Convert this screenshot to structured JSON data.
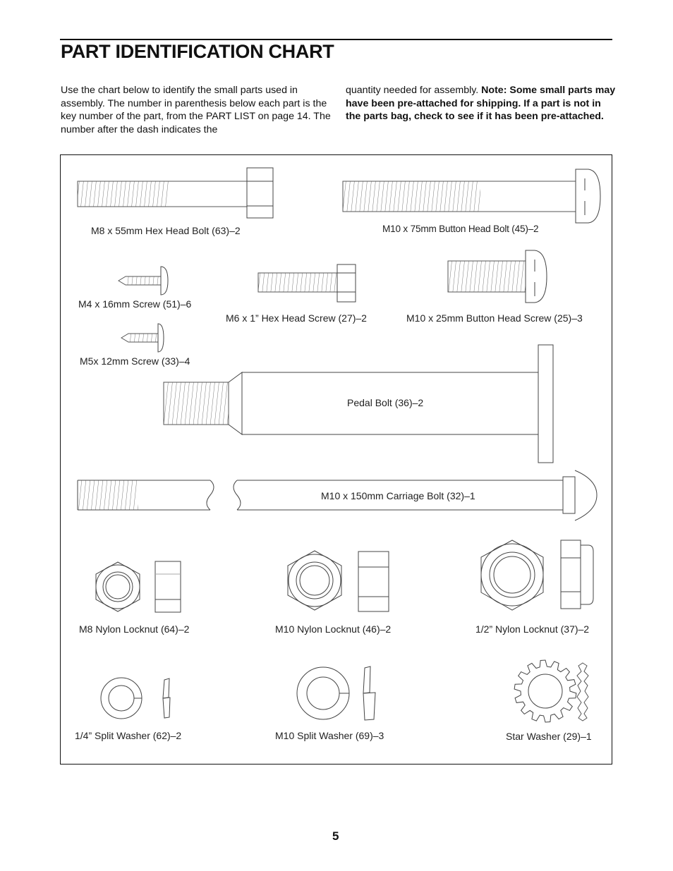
{
  "page": {
    "title": "PART IDENTIFICATION CHART",
    "intro_left": "Use the chart below to identify the small parts used in assembly. The number in parenthesis below each part is the key number of the part, from the PART LIST on page 14. The number after the dash indicates the",
    "intro_right_normal": "quantity needed for assembly. ",
    "intro_right_bold": "Note: Some small parts may have been pre-attached for shipping. If a part is not in the parts bag, check to see if it has been pre-attached.",
    "page_number": "5"
  },
  "parts": [
    {
      "id": "hex-bolt-m8x55",
      "label": "M8 x 55mm Hex Head Bolt (63)–2",
      "key": 63,
      "qty": 2,
      "icon": "hex-head-bolt-icon"
    },
    {
      "id": "button-bolt-m10x75",
      "label": "M10 x 75mm Button Head Bolt (45)–2",
      "key": 45,
      "qty": 2,
      "icon": "button-head-bolt-icon"
    },
    {
      "id": "screw-m4x16",
      "label": "M4 x 16mm Screw (51)–6",
      "key": 51,
      "qty": 6,
      "icon": "screw-icon"
    },
    {
      "id": "hex-screw-m6x1",
      "label": "M6 x 1” Hex Head Screw (27)–2",
      "key": 27,
      "qty": 2,
      "icon": "hex-head-screw-icon"
    },
    {
      "id": "button-screw-m10x25",
      "label": "M10 x 25mm Button Head Screw (25)–3",
      "key": 25,
      "qty": 3,
      "icon": "button-head-screw-icon"
    },
    {
      "id": "screw-m5x12",
      "label": "M5x 12mm Screw (33)–4",
      "key": 33,
      "qty": 4,
      "icon": "screw-icon"
    },
    {
      "id": "pedal-bolt",
      "label": "Pedal Bolt (36)–2",
      "key": 36,
      "qty": 2,
      "icon": "pedal-bolt-icon"
    },
    {
      "id": "carriage-bolt-m10x150",
      "label": "M10 x 150mm Carriage Bolt (32)–1",
      "key": 32,
      "qty": 1,
      "icon": "carriage-bolt-icon"
    },
    {
      "id": "locknut-m8",
      "label": "M8 Nylon Locknut (64)–2",
      "key": 64,
      "qty": 2,
      "icon": "nylon-locknut-icon"
    },
    {
      "id": "locknut-m10",
      "label": "M10 Nylon Locknut (46)–2",
      "key": 46,
      "qty": 2,
      "icon": "nylon-locknut-icon"
    },
    {
      "id": "locknut-half-inch",
      "label": "1/2” Nylon Locknut (37)–2",
      "key": 37,
      "qty": 2,
      "icon": "nylon-locknut-icon"
    },
    {
      "id": "split-washer-quarter",
      "label": "1/4” Split Washer (62)–2",
      "key": 62,
      "qty": 2,
      "icon": "split-washer-icon"
    },
    {
      "id": "split-washer-m10",
      "label": "M10 Split Washer (69)–3",
      "key": 69,
      "qty": 3,
      "icon": "split-washer-icon"
    },
    {
      "id": "star-washer",
      "label": "Star Washer (29)–1",
      "key": 29,
      "qty": 1,
      "icon": "star-washer-icon"
    }
  ]
}
